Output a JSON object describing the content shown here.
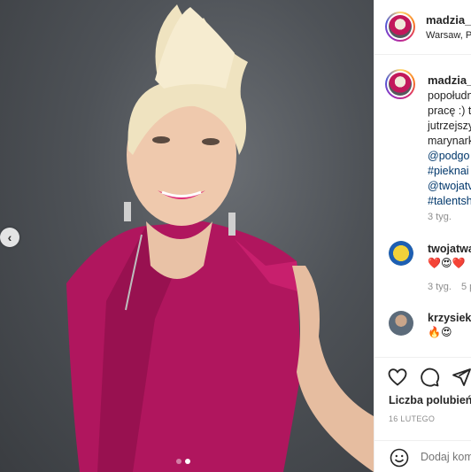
{
  "post": {
    "username": "madzia_p",
    "location": "Warsaw, Po",
    "caption_lines": [
      "popołudn",
      "pracę :) t",
      "jutrzejszy",
      "marynark"
    ],
    "caption_links": [
      "@podgo",
      "#pieknai",
      "@twojatv",
      "#talentsh"
    ],
    "caption_age": "3 tyg.",
    "image_dots": 2,
    "active_dot": 1
  },
  "comments": [
    {
      "username": "twojatwa",
      "emojis": "❤️😍❤️",
      "age": "3 tyg.",
      "likes": "5 p"
    },
    {
      "username": "krzysiek_",
      "emojis": "🔥😍",
      "age": ""
    }
  ],
  "actions": {
    "likes_label": "Liczba polubień:",
    "date": "16 LUTEGO",
    "comment_placeholder": "Dodaj kom"
  },
  "icons": {
    "prev": "chevron-left-icon",
    "like": "heart-icon",
    "comment": "comment-icon",
    "share": "share-icon",
    "emoji": "smiley-icon"
  }
}
